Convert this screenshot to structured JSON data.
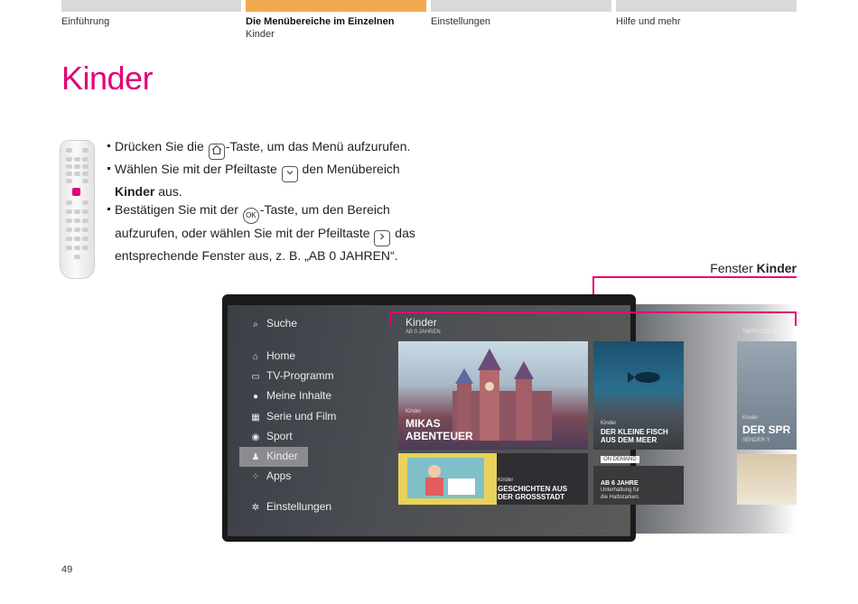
{
  "header": {
    "tabs": [
      {
        "label": "Einführung",
        "color": "#d9d9d9"
      },
      {
        "label": "Die Menübereiche im Einzelnen",
        "sub": "Kinder",
        "color": "#f0a94e"
      },
      {
        "label": "Einstellungen",
        "color": "#d9d9d9"
      },
      {
        "label": "Hilfe und mehr",
        "color": "#d9d9d9"
      }
    ]
  },
  "page": {
    "title": "Kinder",
    "page_number": "49",
    "accent": "#e20074"
  },
  "instructions": {
    "b1_pre": "Drücken Sie die",
    "b1_key": "home-icon",
    "b1_post": "-Taste, um das Menü aufzurufen.",
    "b2_pre": "Wählen Sie mit der Pfeiltaste",
    "b2_key": "arrow-down-icon",
    "b2_post": "den Menübereich",
    "b2_bold": "Kinder",
    "b2_end": "aus.",
    "b3_pre": "Bestätigen Sie mit der",
    "b3_key": "OK",
    "b3_post": "-Taste, um den Bereich",
    "b3_line2": "aufzurufen, oder wählen Sie mit der Pfeiltaste",
    "b3_key2": "arrow-right-icon",
    "b3_post2": "das",
    "b3_line3": "entsprechende Fenster aus, z. B. „AB 0 JAHREN“."
  },
  "callout": {
    "prefix": "Fenster",
    "bold": "Kinder"
  },
  "tv": {
    "search": "Suche",
    "menu": [
      {
        "label": "Home",
        "icon": "home-icon"
      },
      {
        "label": "TV-Programm",
        "icon": "tv-icon"
      },
      {
        "label": "Meine Inhalte",
        "icon": "person-icon"
      },
      {
        "label": "Serie und Film",
        "icon": "clapper-icon"
      },
      {
        "label": "Sport",
        "icon": "ball-icon"
      },
      {
        "label": "Kinder",
        "icon": "kids-icon",
        "selected": true
      },
      {
        "label": "Apps",
        "icon": "apps-icon"
      },
      {
        "label": "Einstellungen",
        "icon": "gear-icon"
      }
    ],
    "section_title": "Kinder",
    "section_sub": "AB 0 JAHREN",
    "tips": "TIPPS DER WOCHE",
    "tiles": [
      {
        "tag": "Kinder",
        "title_l1": "MIKAS",
        "title_l2": "ABENTEUER"
      },
      {
        "tag": "Kinder",
        "title_l1": "DER KLEINE FISCH",
        "title_l2": "AUS DEM MEER",
        "badge": "ON DEMAND"
      },
      {
        "tag": "Kinder",
        "title_l1": "GESCHICHTEN AUS",
        "title_l2": "DER GROSSSTADT"
      },
      {
        "tag": "",
        "title_l1": "AB 6 JAHRE",
        "title_l2": "Unterhaltung für",
        "title_l3": "die Halbstarken."
      },
      {
        "tag": "Kinder",
        "title_l1": "DER SPR",
        "title_l2": "SENDER Y"
      }
    ]
  }
}
